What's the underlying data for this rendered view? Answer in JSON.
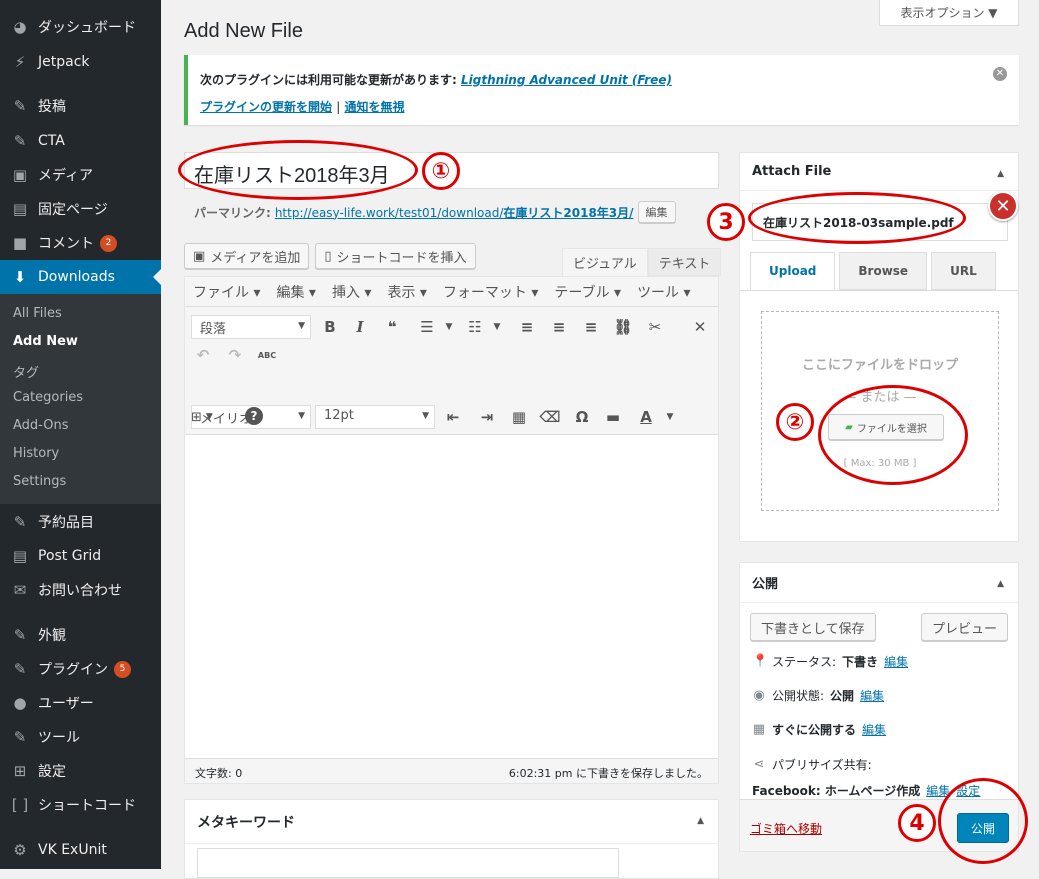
{
  "sidebar": {
    "items": [
      {
        "label": "ダッシュボード",
        "icon": "dashboard-icon",
        "glyph": "◕"
      },
      {
        "label": "Jetpack",
        "icon": "jetpack-icon",
        "glyph": "⚡"
      },
      {
        "label": "投稿",
        "icon": "pin-icon",
        "glyph": "✎"
      },
      {
        "label": "CTA",
        "icon": "pin-icon",
        "glyph": "✎"
      },
      {
        "label": "メディア",
        "icon": "media-icon",
        "glyph": "▣"
      },
      {
        "label": "固定ページ",
        "icon": "page-icon",
        "glyph": "▤"
      },
      {
        "label": "コメント",
        "icon": "comment-icon",
        "glyph": "■",
        "badge": "2"
      },
      {
        "label": "Downloads",
        "icon": "download-icon",
        "glyph": "⬇"
      },
      {
        "label": "予約品目",
        "icon": "pin-icon",
        "glyph": "✎"
      },
      {
        "label": "Post Grid",
        "icon": "page-icon",
        "glyph": "▤"
      },
      {
        "label": "お問い合わせ",
        "icon": "mail-icon",
        "glyph": "✉"
      },
      {
        "label": "外観",
        "icon": "appearance-icon",
        "glyph": "✎"
      },
      {
        "label": "プラグイン",
        "icon": "plugin-icon",
        "glyph": "✎",
        "badge": "5"
      },
      {
        "label": "ユーザー",
        "icon": "user-icon",
        "glyph": "●"
      },
      {
        "label": "ツール",
        "icon": "tool-icon",
        "glyph": "✎"
      },
      {
        "label": "設定",
        "icon": "settings-icon",
        "glyph": "⊞"
      },
      {
        "label": "ショートコード",
        "icon": "shortcode-icon",
        "glyph": "[ ]"
      },
      {
        "label": "VK ExUnit",
        "icon": "gear-icon",
        "glyph": "⚙"
      }
    ],
    "submenu": [
      "All Files",
      "Add New",
      "タグ",
      "Categories",
      "Add-Ons",
      "History",
      "Settings"
    ]
  },
  "header": {
    "screen_options": "表示オプション ▼",
    "title": "Add New File"
  },
  "notice": {
    "text": "次のプラグインには利用可能な更新があります:",
    "plugin_link": "Ligthning Advanced Unit (Free)",
    "start_update": "プラグインの更新を開始",
    "separator": "|",
    "dismiss": "通知を無視"
  },
  "post": {
    "title": "在庫リスト2018年3月",
    "permalink_label": "パーマリンク:",
    "permalink_url": "http://easy-life.work/test01/download/",
    "permalink_slug": "在庫リスト2018年3月/",
    "edit": "編集"
  },
  "editor": {
    "add_media": "メディアを追加",
    "shortcode": "ショートコードを挿入",
    "tab_visual": "ビジュアル",
    "tab_text": "テキスト",
    "menu": [
      "ファイル ▾",
      "編集 ▾",
      "挿入 ▾",
      "表示 ▾",
      "フォーマット ▾",
      "テーブル ▾",
      "ツール ▾"
    ],
    "format": "段落",
    "font": "メイリオ",
    "size": "12pt",
    "word_count": "文字数: 0",
    "saved": "6:02:31 pm に下書きを保存しました。"
  },
  "meta_keyword": {
    "title": "メタキーワード"
  },
  "attach": {
    "title": "Attach File",
    "file_name": "在庫リスト2018-03sample.pdf",
    "tabs": [
      "Upload",
      "Browse",
      "URL"
    ],
    "drop": "ここにファイルをドロップ",
    "or": "— または —",
    "choose": "ファイルを選択",
    "max": "[ Max: 30 MB ]"
  },
  "publish": {
    "title": "公開",
    "save_draft": "下書きとして保存",
    "preview": "プレビュー",
    "status_label": "ステータス:",
    "status_value": "下書き",
    "visibility_label": "公開状態:",
    "visibility_value": "公開",
    "schedule_label": "すぐに公開する",
    "share_label": "パブリサイズ共有:",
    "share_value": "Facebook: ホームページ作成",
    "edit": "編集",
    "settings": "設定",
    "trash": "ゴミ箱へ移動",
    "publish": "公開"
  },
  "annotations": [
    "①",
    "②",
    "3",
    "4"
  ],
  "colors": {
    "accent": "#0073aa",
    "annotation": "#dd0000",
    "sidebar": "#23282d"
  }
}
